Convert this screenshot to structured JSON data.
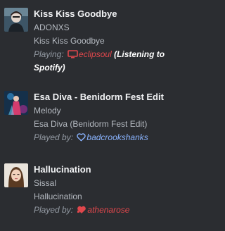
{
  "tracks": [
    {
      "title": "Kiss Kiss Goodbye",
      "artist": "ADONXS",
      "album": "Kiss Kiss Goodbye",
      "status_label": "Playing:",
      "user": "eclipsoul",
      "note": "(Listening to Spotify)",
      "icon": "monitor-icon",
      "accent": "#e0474c"
    },
    {
      "title": "Esa Diva - Benidorm Fest Edit",
      "artist": "Melody",
      "album": "Esa Diva (Benidorm Fest Edit)",
      "status_label": "Played by:",
      "user": "badcrookshanks",
      "icon": "heart-outline-icon",
      "accent": "#8ab4ff"
    },
    {
      "title": "Hallucination",
      "artist": "Sissal",
      "album": "Hallucination",
      "status_label": "Played by:",
      "user": "athenarose",
      "icon": "heart-filled-icon",
      "accent": "#e0474c"
    }
  ]
}
